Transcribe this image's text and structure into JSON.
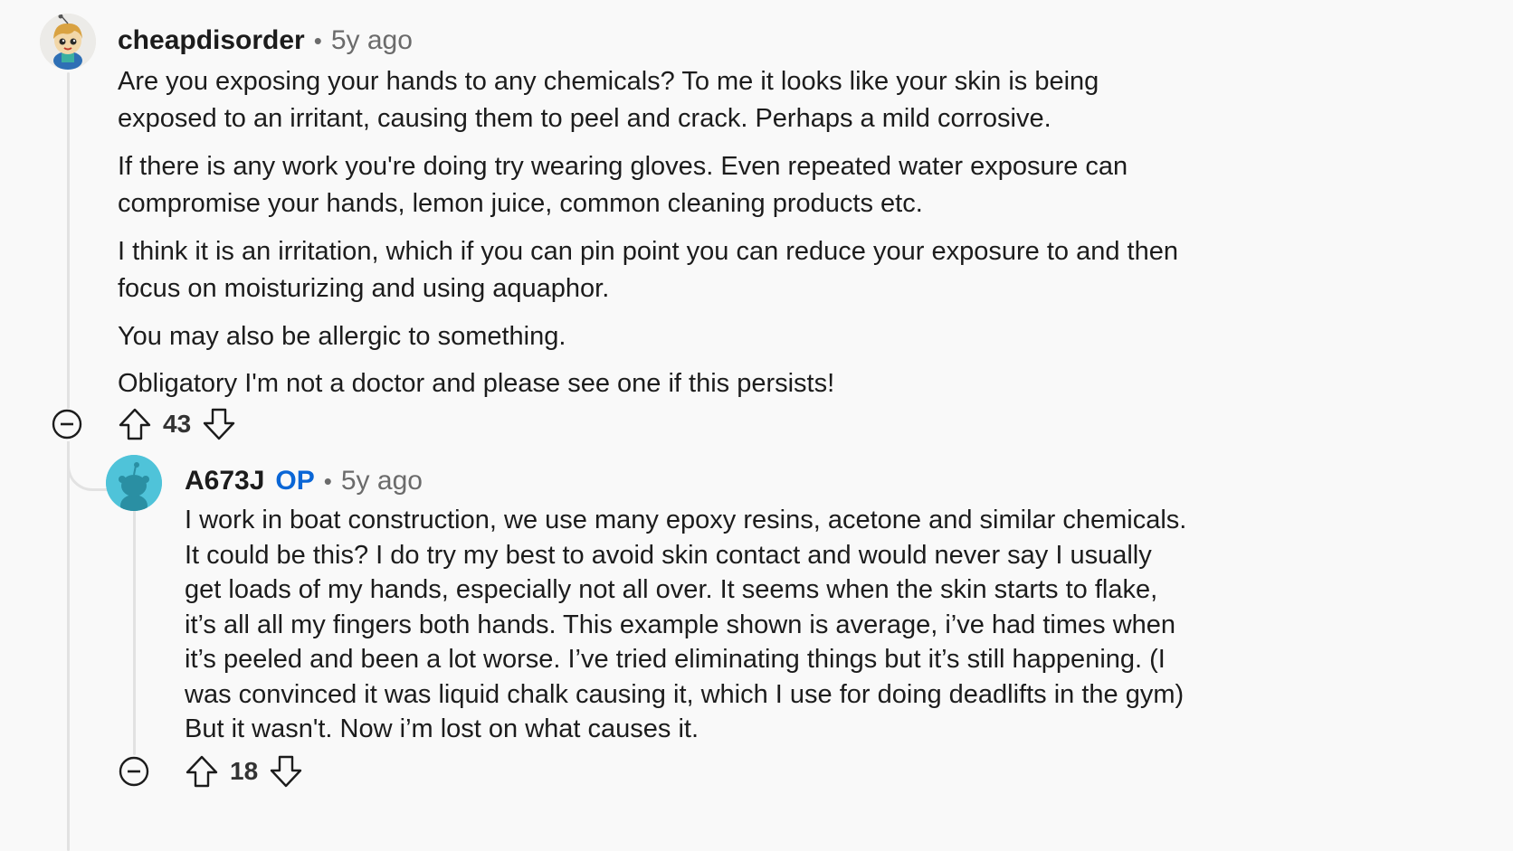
{
  "comments": [
    {
      "username": "cheapdisorder",
      "separator": "•",
      "time": "5y ago",
      "avatar_icon": "snoo-avatar-icon",
      "paragraphs": [
        "Are you exposing your hands to any chemicals? To me it looks like your skin is being exposed to an irritant, causing them to peel and crack. Perhaps a mild corrosive.",
        "If there is any work you're doing try wearing gloves. Even repeated water exposure can compromise your hands, lemon juice, common cleaning products etc.",
        "I think it is an irritation, which if you can pin point you can reduce your exposure to and then focus on moisturizing and using aquaphor.",
        "You may also be allergic to something.",
        "Obligatory I'm not a doctor and please see one if this persists!"
      ],
      "votes": "43"
    },
    {
      "username": "A673J",
      "op_badge": "OP",
      "separator": "•",
      "time": "5y ago",
      "avatar_icon": "default-snoo-avatar-icon",
      "paragraphs": [
        "I work in boat construction, we use many epoxy resins, acetone and similar chemicals. It could be this? I do try my best to avoid skin contact and would never say I usually get loads of my hands, especially not all over. It seems when the skin starts to flake, it’s all all my fingers both hands. This example shown is average, i’ve had times when it’s peeled and been a lot worse. I’ve tried eliminating things but it’s still happening. (I was convinced it was liquid chalk causing it, which I use for doing deadlifts in the gym) But it wasn't. Now i’m lost on what causes it."
      ],
      "votes": "18"
    }
  ],
  "colors": {
    "op": "#0a66d6",
    "muted": "#6b6b6b",
    "thread_line": "#e2e2e2",
    "avatar2_bg": "#4fc3d9"
  }
}
